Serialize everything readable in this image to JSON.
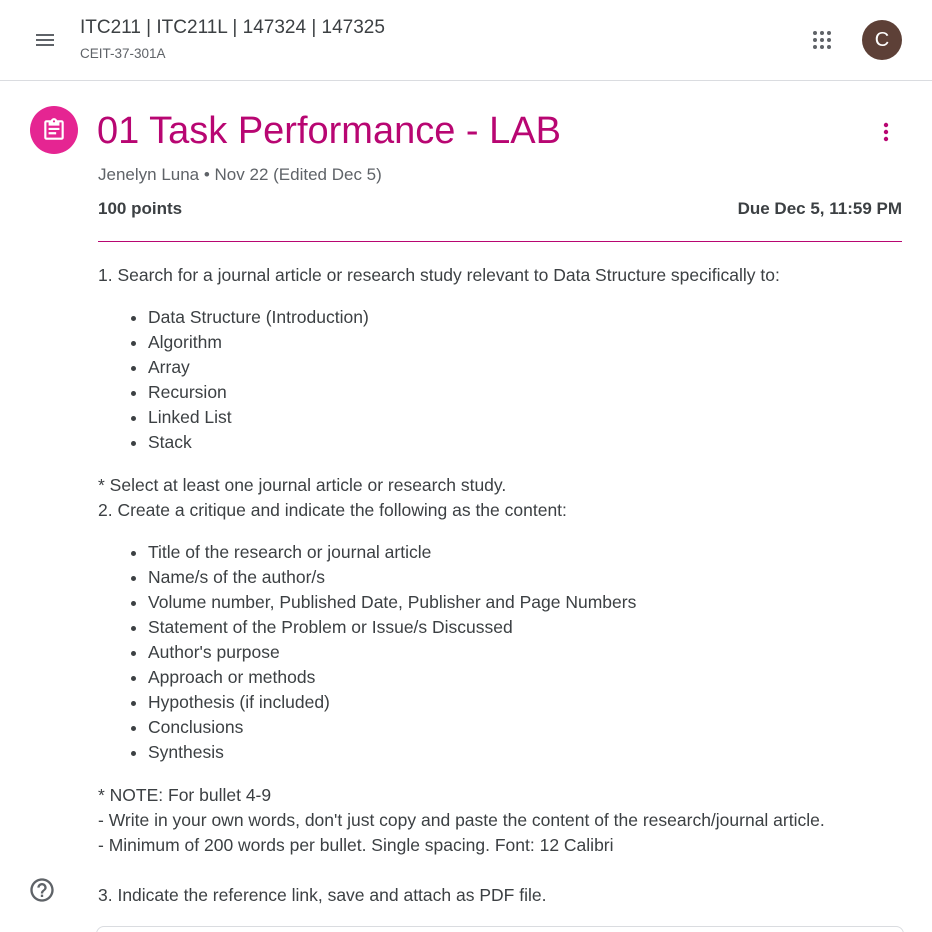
{
  "header": {
    "class_title": "ITC211 | ITC211L | 147324 | 147325",
    "class_section": "CEIT-37-301A",
    "avatar_letter": "C",
    "icons": {
      "menu": "hamburger-menu-icon",
      "apps": "apps-grid-icon",
      "help": "help-circle-icon"
    }
  },
  "assignment": {
    "title": "01 Task Performance - LAB",
    "meta": "Jenelyn Luna • Nov 22 (Edited Dec 5)",
    "points": "100 points",
    "due": "Due Dec 5, 11:59 PM",
    "accent_color": "#b80672",
    "icon_color": "#e52592",
    "icon": "assignment-clipboard-icon"
  },
  "instructions": {
    "step1": "1. Search for a journal article or research study relevant to Data Structure specifically to:",
    "topics": [
      "Data Structure (Introduction)",
      "Algorithm",
      "Array",
      "Recursion",
      "Linked List",
      "Stack"
    ],
    "select_note": "* Select at least one journal article or research study.",
    "step2": "2. Create a critique and indicate the following as the content:",
    "critique_items": [
      "Title of the research or journal article",
      "Name/s of the author/s",
      "Volume number, Published Date, Publisher and Page Numbers",
      "Statement of the Problem or Issue/s Discussed",
      "Author's purpose",
      "Approach or methods",
      "Hypothesis (if included)",
      "Conclusions",
      "Synthesis"
    ],
    "note_title": "* NOTE: For bullet 4-9",
    "note_1": "- Write in your own words, don't just copy and paste the content of the research/journal article.",
    "note_2": "- Minimum of 200 words per bullet. Single spacing. Font: 12 Calibri",
    "step3": "3. Indicate the reference link, save and attach as PDF file."
  }
}
